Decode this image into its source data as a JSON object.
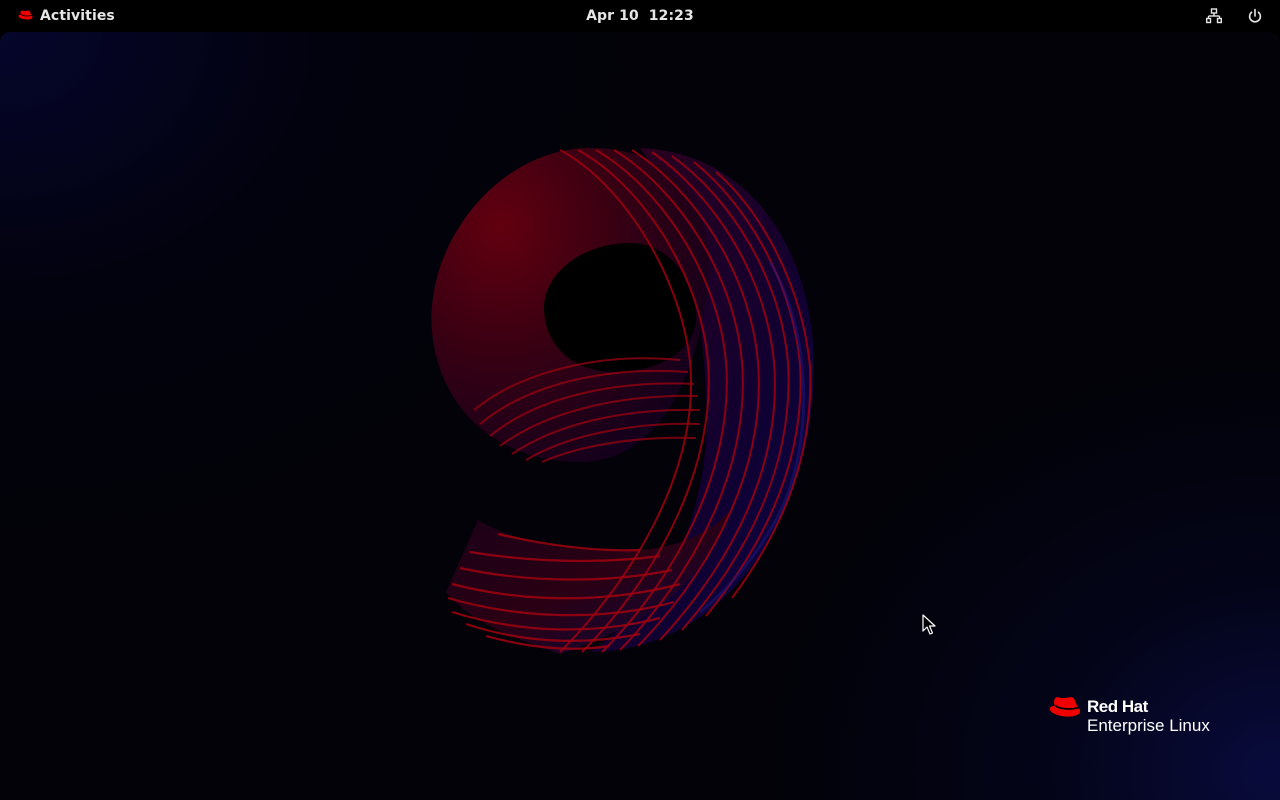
{
  "panel": {
    "activities_label": "Activities",
    "clock": "Apr 10  12:23",
    "network_icon": "network-wired-icon",
    "power_icon": "power-icon"
  },
  "wallpaper": {
    "motif": "9",
    "brand_name": "Red Hat",
    "brand_product": "Enterprise Linux",
    "brand_icon": "red-hat-logo-icon"
  },
  "colors": {
    "panel_background": "#000000",
    "accent_red": "#ee0000",
    "wallpaper_blue": "#0a0c46"
  }
}
